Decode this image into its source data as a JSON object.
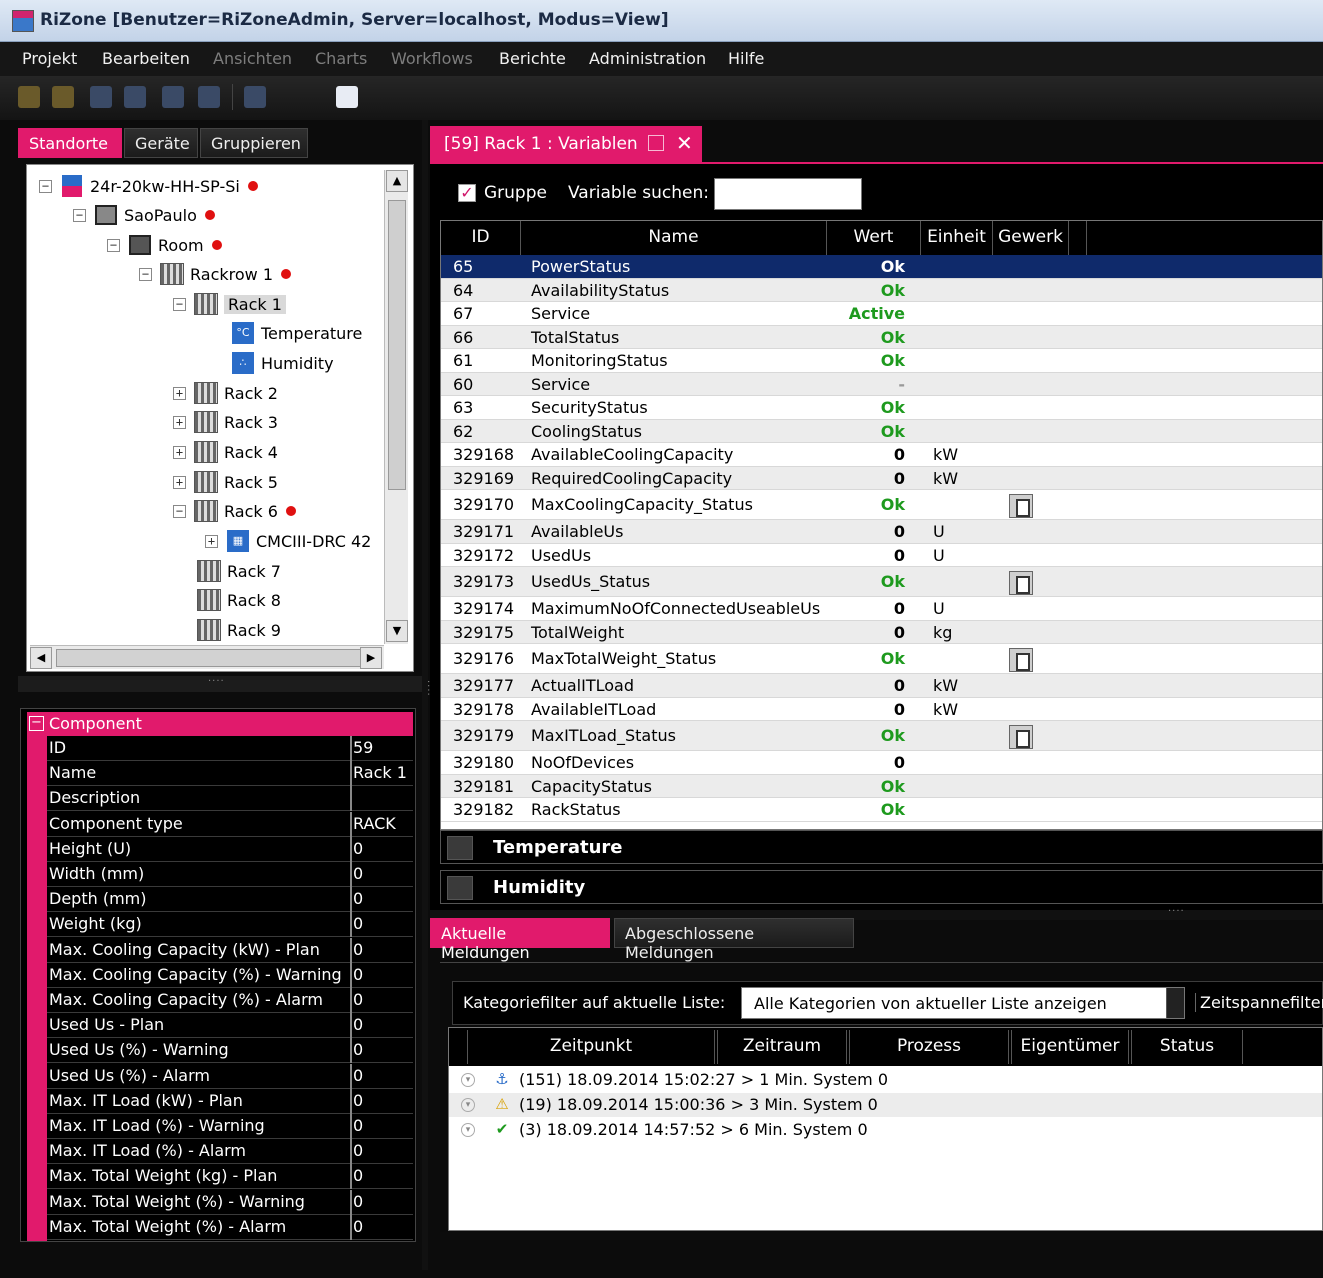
{
  "window": {
    "title": "RiZone [Benutzer=RiZoneAdmin, Server=localhost, Modus=View]"
  },
  "menu": [
    {
      "label": "Projekt",
      "enabled": true
    },
    {
      "label": "Bearbeiten",
      "enabled": true
    },
    {
      "label": "Ansichten",
      "enabled": false
    },
    {
      "label": "Charts",
      "enabled": false
    },
    {
      "label": "Workflows",
      "enabled": false
    },
    {
      "label": "Berichte",
      "enabled": true
    },
    {
      "label": "Administration",
      "enabled": true
    },
    {
      "label": "Hilfe",
      "enabled": true
    }
  ],
  "left_tabs": [
    "Standorte",
    "Geräte",
    "Gruppieren"
  ],
  "tree": [
    {
      "label": "24r-20kw-HH-SP-Si",
      "alarm": true
    },
    {
      "label": "SaoPaulo",
      "alarm": true
    },
    {
      "label": "Room",
      "alarm": true
    },
    {
      "label": "Rackrow 1",
      "alarm": true
    },
    {
      "label": "Rack 1",
      "alarm": false
    },
    {
      "label": "Temperature",
      "alarm": false
    },
    {
      "label": "Humidity",
      "alarm": false
    },
    {
      "label": "Rack 2",
      "alarm": false
    },
    {
      "label": "Rack 3",
      "alarm": false
    },
    {
      "label": "Rack 4",
      "alarm": false
    },
    {
      "label": "Rack 5",
      "alarm": false
    },
    {
      "label": "Rack 6",
      "alarm": true
    },
    {
      "label": "CMCIII-DRC 42",
      "alarm": false
    },
    {
      "label": "Rack 7",
      "alarm": false
    },
    {
      "label": "Rack 8",
      "alarm": false
    },
    {
      "label": "Rack 9",
      "alarm": false
    }
  ],
  "properties": {
    "category": "Component",
    "rows": [
      {
        "key": "ID",
        "value": "59"
      },
      {
        "key": "Name",
        "value": "Rack 1"
      },
      {
        "key": "Description",
        "value": ""
      },
      {
        "key": "Component type",
        "value": "RACK"
      },
      {
        "key": "Height (U)",
        "value": "0"
      },
      {
        "key": "Width (mm)",
        "value": "0"
      },
      {
        "key": "Depth (mm)",
        "value": "0"
      },
      {
        "key": "Weight (kg)",
        "value": "0"
      },
      {
        "key": "Max. Cooling Capacity (kW) - Plan",
        "value": "0"
      },
      {
        "key": "Max. Cooling Capacity (%) - Warning",
        "value": "0"
      },
      {
        "key": "Max. Cooling Capacity (%) - Alarm",
        "value": "0"
      },
      {
        "key": "Used Us - Plan",
        "value": "0"
      },
      {
        "key": "Used Us (%) - Warning",
        "value": "0"
      },
      {
        "key": "Used Us (%) - Alarm",
        "value": "0"
      },
      {
        "key": "Max. IT Load (kW) - Plan",
        "value": "0"
      },
      {
        "key": "Max. IT Load (%) - Warning",
        "value": "0"
      },
      {
        "key": "Max. IT Load (%) - Alarm",
        "value": "0"
      },
      {
        "key": "Max. Total Weight (kg) - Plan",
        "value": "0"
      },
      {
        "key": "Max. Total Weight (%) - Warning",
        "value": "0"
      },
      {
        "key": "Max. Total Weight (%) - Alarm",
        "value": "0"
      }
    ]
  },
  "doc_tab": {
    "title": "[59] Rack 1 : Variablen"
  },
  "variables": {
    "group_checkbox_label": "Gruppe",
    "group_checked": true,
    "search_label": "Variable suchen:",
    "search_value": "",
    "columns": [
      "ID",
      "Name",
      "Wert",
      "Einheit",
      "Gewerk"
    ],
    "rows": [
      {
        "id": "65",
        "name": "PowerStatus",
        "value": "Ok",
        "unit": "",
        "icon": false
      },
      {
        "id": "64",
        "name": "AvailabilityStatus",
        "value": "Ok",
        "unit": "",
        "icon": false
      },
      {
        "id": "67",
        "name": "Service",
        "value": "Active",
        "unit": "",
        "icon": false
      },
      {
        "id": "66",
        "name": "TotalStatus",
        "value": "Ok",
        "unit": "",
        "icon": false
      },
      {
        "id": "61",
        "name": "MonitoringStatus",
        "value": "Ok",
        "unit": "",
        "icon": false
      },
      {
        "id": "60",
        "name": "Service",
        "value": "-",
        "unit": "",
        "icon": false
      },
      {
        "id": "63",
        "name": "SecurityStatus",
        "value": "Ok",
        "unit": "",
        "icon": false
      },
      {
        "id": "62",
        "name": "CoolingStatus",
        "value": "Ok",
        "unit": "",
        "icon": false
      },
      {
        "id": "329168",
        "name": "AvailableCoolingCapacity",
        "value": "0",
        "unit": "kW",
        "icon": false
      },
      {
        "id": "329169",
        "name": "RequiredCoolingCapacity",
        "value": "0",
        "unit": "kW",
        "icon": false
      },
      {
        "id": "329170",
        "name": "MaxCoolingCapacity_Status",
        "value": "Ok",
        "unit": "",
        "icon": true
      },
      {
        "id": "329171",
        "name": "AvailableUs",
        "value": "0",
        "unit": "U",
        "icon": false
      },
      {
        "id": "329172",
        "name": "UsedUs",
        "value": "0",
        "unit": "U",
        "icon": false
      },
      {
        "id": "329173",
        "name": "UsedUs_Status",
        "value": "Ok",
        "unit": "",
        "icon": true
      },
      {
        "id": "329174",
        "name": "MaximumNoOfConnectedUseableUs",
        "value": "0",
        "unit": "U",
        "icon": false
      },
      {
        "id": "329175",
        "name": "TotalWeight",
        "value": "0",
        "unit": "kg",
        "icon": false
      },
      {
        "id": "329176",
        "name": "MaxTotalWeight_Status",
        "value": "Ok",
        "unit": "",
        "icon": true
      },
      {
        "id": "329177",
        "name": "ActualITLoad",
        "value": "0",
        "unit": "kW",
        "icon": false
      },
      {
        "id": "329178",
        "name": "AvailableITLoad",
        "value": "0",
        "unit": "kW",
        "icon": false
      },
      {
        "id": "329179",
        "name": "MaxITLoad_Status",
        "value": "Ok",
        "unit": "",
        "icon": true
      },
      {
        "id": "329180",
        "name": "NoOfDevices",
        "value": "0",
        "unit": "",
        "icon": false
      },
      {
        "id": "329181",
        "name": "CapacityStatus",
        "value": "Ok",
        "unit": "",
        "icon": false
      },
      {
        "id": "329182",
        "name": "RackStatus",
        "value": "Ok",
        "unit": "",
        "icon": false
      }
    ],
    "groups": [
      "Temperature",
      "Humidity"
    ]
  },
  "messages": {
    "tabs": [
      "Aktuelle Meldungen",
      "Abgeschlossene Meldungen"
    ],
    "filter_label": "Kategoriefilter auf aktuelle Liste:",
    "filter_value": "Alle Kategorien von aktueller Liste anzeigen",
    "timespan_label": "Zeitspannefilter",
    "columns": [
      "Zeitpunkt",
      "Zeitraum",
      "Prozess",
      "Eigentümer",
      "Status"
    ],
    "rows": [
      {
        "icon": "info-icon",
        "text": "(151) 18.09.2014 15:02:27 > 1 Min. System  0"
      },
      {
        "icon": "warning-icon",
        "text": "(19) 18.09.2014 15:00:36 > 3 Min. System  0"
      },
      {
        "icon": "check-icon",
        "text": "(3) 18.09.2014 14:57:52 > 6 Min. System  0"
      }
    ]
  },
  "colors": {
    "accent": "#e11a6c",
    "ok": "#1e9a1e",
    "selection": "#0f2a6b"
  }
}
